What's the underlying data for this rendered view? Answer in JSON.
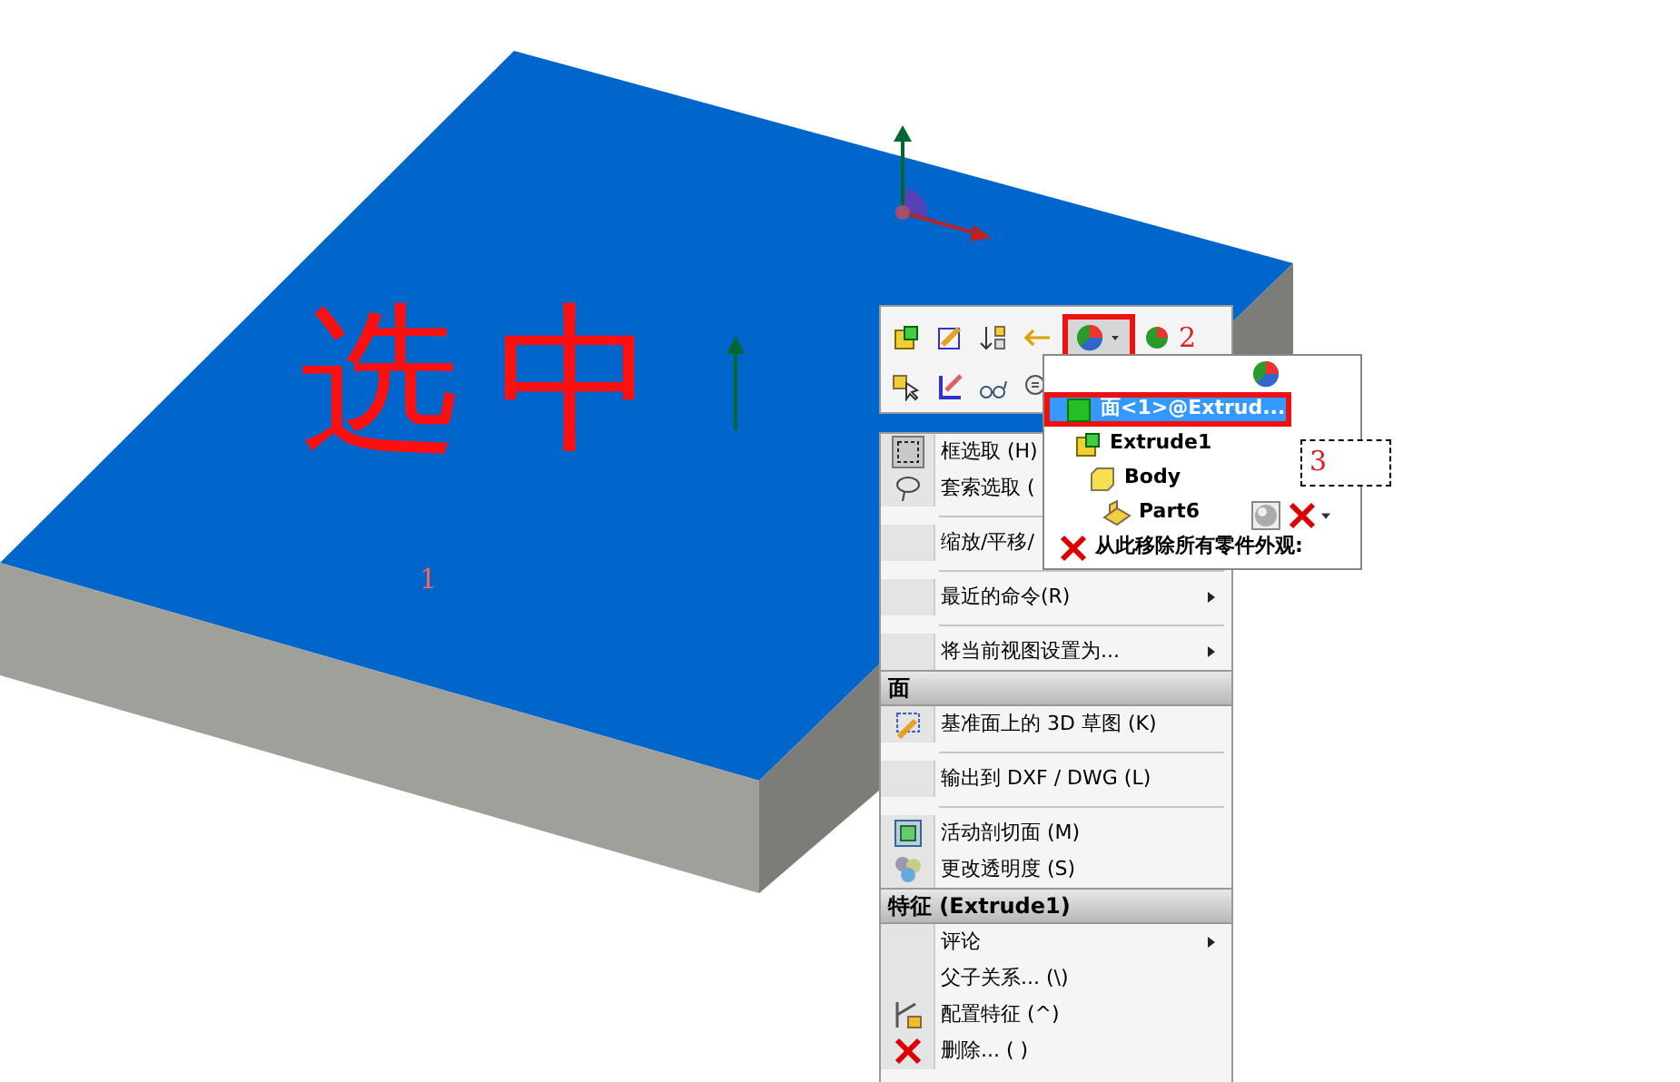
{
  "annotation": {
    "handwriting": "选中",
    "markers": [
      "1",
      "2",
      "3"
    ]
  },
  "appearance_popup": {
    "tree": [
      {
        "label": "面<1>@Extrud...",
        "selected": true,
        "children": [
          {
            "label": "Extrude1",
            "selected": false,
            "children": [
              {
                "label": "Body",
                "selected": false,
                "children": [
                  {
                    "label": "Part6",
                    "selected": false
                  }
                ]
              }
            ]
          }
        ]
      }
    ],
    "footer": "从此移除所有零件外观:"
  },
  "context_menu": {
    "items": [
      {
        "kind": "item",
        "label": "框选取 (H)"
      },
      {
        "kind": "item",
        "label": "套索选取 ("
      },
      {
        "kind": "separator"
      },
      {
        "kind": "item",
        "label": "缩放/平移/"
      },
      {
        "kind": "separator"
      },
      {
        "kind": "item",
        "label": "最近的命令(R)",
        "submenu": true
      },
      {
        "kind": "separator"
      },
      {
        "kind": "item",
        "label": "将当前视图设置为...",
        "submenu": true
      },
      {
        "kind": "header",
        "label": "面"
      },
      {
        "kind": "item",
        "label": "基准面上的 3D 草图 (K)",
        "submenu": false
      },
      {
        "kind": "separator"
      },
      {
        "kind": "item",
        "label": "输出到 DXF / DWG (L)",
        "submenu": false
      },
      {
        "kind": "separator"
      },
      {
        "kind": "item",
        "label": "活动剖切面 (M)",
        "submenu": false
      },
      {
        "kind": "item",
        "label": "更改透明度 (S)",
        "submenu": false
      },
      {
        "kind": "header",
        "label": "特征 (Extrude1)"
      },
      {
        "kind": "item",
        "label": "评论",
        "submenu": true
      },
      {
        "kind": "item",
        "label": "父子关系... (\\)",
        "submenu": false
      },
      {
        "kind": "item",
        "label": "配置特征 (^)",
        "submenu": false
      },
      {
        "kind": "item",
        "label": "删除... ( )",
        "submenu": false
      }
    ]
  }
}
